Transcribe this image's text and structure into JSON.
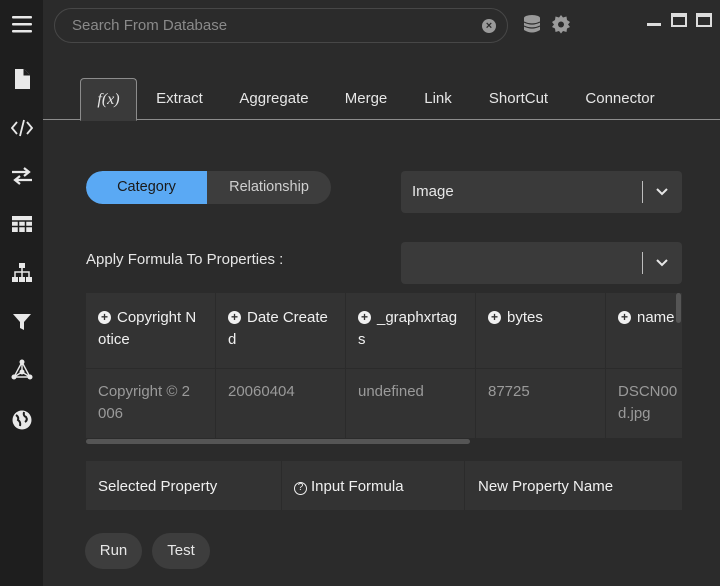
{
  "search": {
    "placeholder": "Search From Database"
  },
  "sidebar": {
    "icons": [
      "menu-icon",
      "document-icon",
      "code-icon",
      "swap-icon",
      "table-icon",
      "hierarchy-icon",
      "filter-icon",
      "network-icon",
      "globe-icon"
    ]
  },
  "toolbar": {
    "icons": [
      "database-icon",
      "gear-icon"
    ]
  },
  "window": {
    "controls": [
      "minimize-icon",
      "restore-icon",
      "close-icon"
    ]
  },
  "tabs": [
    {
      "label": "f(x)",
      "active": true
    },
    {
      "label": "Extract"
    },
    {
      "label": "Aggregate"
    },
    {
      "label": "Merge"
    },
    {
      "label": "Link"
    },
    {
      "label": "ShortCut"
    },
    {
      "label": "Connector"
    }
  ],
  "toggle": {
    "left": "Category",
    "right": "Relationship",
    "selected": "Category"
  },
  "category_select": {
    "value": "Image"
  },
  "apply_label": "Apply Formula To Properties :",
  "apply_select": {
    "value": ""
  },
  "table": {
    "columns": [
      {
        "header_line1": "Copyright N",
        "header_line2": "otice",
        "value_line1": "Copyright © 2",
        "value_line2": "006"
      },
      {
        "header_line1": "Date Create",
        "header_line2": "d",
        "value_line1": "20060404",
        "value_line2": ""
      },
      {
        "header_line1": "_graphxrtag",
        "header_line2": "s",
        "value_line1": "undefined",
        "value_line2": ""
      },
      {
        "header_line1": "bytes",
        "header_line2": "",
        "value_line1": "87725",
        "value_line2": ""
      },
      {
        "header_line1": "name",
        "header_line2": "",
        "value_line1": "DSCN00",
        "value_line2": "d.jpg"
      }
    ]
  },
  "properties": {
    "selected": "Selected Property",
    "formula": "Input Formula",
    "new_name": "New Property Name"
  },
  "actions": {
    "run": "Run",
    "test": "Test"
  },
  "colors": {
    "accent": "#5aa9f4",
    "background": "#2b2b2b",
    "sidebar": "#1e1e1e"
  }
}
